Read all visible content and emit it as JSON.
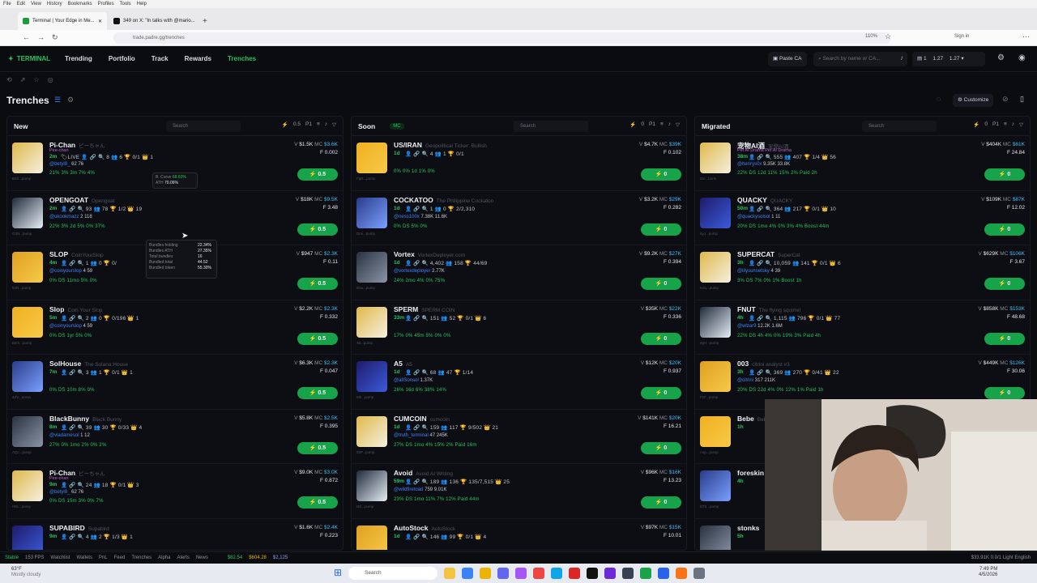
{
  "browser": {
    "menu": [
      "File",
      "Edit",
      "View",
      "History",
      "Bookmarks",
      "Profiles",
      "Tools",
      "Help"
    ],
    "tabs": [
      {
        "title": "Terminal | Your Edge in Me..."
      },
      {
        "title": "349 on X: \"In talks with @mario..."
      }
    ],
    "url": "trade.padre.gg/trenches",
    "zoom": "110%",
    "signin": "Sign in"
  },
  "nav": {
    "logo": "TERMINAL",
    "items": [
      "Trending",
      "Portfolio",
      "Track",
      "Rewards",
      "Trenches"
    ],
    "paste_ca": "Paste CA",
    "search_placeholder": "Search by name or CA...",
    "search_key": "/",
    "wallet_count": "1",
    "balance_a": "1.27",
    "balance_b": "1.27"
  },
  "page": {
    "title": "Trenches",
    "customize": "Customize"
  },
  "columns": [
    {
      "title": "New",
      "search": "Search",
      "preset": "0.5",
      "p": "P1",
      "cards": [
        {
          "name": "Pi-Chan",
          "desc": "ピーちゃん",
          "sub": "Pee-chan",
          "age": "2m",
          "stats": "🏷LIVE 👤 🔗 🔍 8  👥 6  🏆 0/1  👑 1",
          "handle": "@betyl8_",
          "handle_stats": "62  76",
          "bottom": "21%  3%  3m  7%  4%",
          "vol": "$1.5K",
          "mc": "$3.6K",
          "f": "F 0.002",
          "tx": "",
          "buy": "0.5",
          "addr": "BsX...pump"
        },
        {
          "name": "OPENGOAT",
          "desc": "Opengoat",
          "sub": "",
          "age": "2m",
          "stats": "👤 🔗 🔍 93  👥 78  🏆 1/2  👑 19",
          "handle": "@ukookmazz",
          "handle_stats": "2  118",
          "bottom": "22%  3%  2d  5%  0%  37%",
          "vol": "$18K",
          "mc": "$9.5K",
          "f": "F 3.48",
          "tx": "",
          "buy": "0.5",
          "addr": "G3N...pump"
        },
        {
          "name": "SLOP",
          "desc": "CoinYourSlop",
          "sub": "",
          "age": "4m",
          "stats": "👤 🔗 🔍 1  👥 0  🏆 0/",
          "handle": "@coinyourslop",
          "handle_stats": "4  59",
          "bottom": "0%  DS 11mo  5%  0%",
          "vol": "$947",
          "mc": "$2.3K",
          "f": "F 0.11",
          "tx": "",
          "buy": "0.5",
          "addr": "52N...pump"
        },
        {
          "name": "Slop",
          "desc": "Coin Your Slop",
          "sub": "",
          "age": "5m",
          "stats": "👤 🔗 🔍 2  👥 0  🏆 0/196  👑 1",
          "handle": "@coinyourslop",
          "handle_stats": "4  59",
          "bottom": "0%  DS 1yr  5%  0%",
          "vol": "$2.2K",
          "mc": "$2.3K",
          "f": "F 0.332",
          "tx": "",
          "buy": "0.5",
          "addr": "B2m...pump"
        },
        {
          "name": "SolHouse",
          "desc": "The Solana House",
          "sub": "",
          "age": "7m",
          "stats": "👤 🔗 🔍 3  👥 1  🏆 0/1  👑 1",
          "handle": "",
          "handle_stats": "",
          "bottom": "0%  DS 10m  8%  0%",
          "vol": "$6.3K",
          "mc": "$2.3K",
          "f": "F 0.047",
          "tx": "",
          "buy": "0.5",
          "addr": "4ZV...pump"
        },
        {
          "name": "BlackBunny",
          "desc": "Black Bunny",
          "sub": "",
          "age": "8m",
          "stats": "👤 🔗 🔍 39  👥 30  🏆 0/33  👑 4",
          "handle": "@vladamesol",
          "handle_stats": "1  12",
          "bottom": "27%  0%  1mo  2%  0%  2%",
          "vol": "$5.8K",
          "mc": "$2.5K",
          "f": "F 0.395",
          "tx": "",
          "buy": "0.5",
          "addr": "AQc...pump"
        },
        {
          "name": "Pi-Chan",
          "desc": "ピーちゃん",
          "sub": "Pee-chan",
          "age": "9m",
          "stats": "👤 🔗 🔍 24  👥 18  🏆 0/1  👑 3",
          "handle": "@betyl8_",
          "handle_stats": "62  76",
          "bottom": "0%  DS 15m  3%  0%  7%",
          "vol": "$9.0K",
          "mc": "$3.0K",
          "f": "F 0.872",
          "tx": "",
          "buy": "0.5",
          "addr": "H8c...pump"
        },
        {
          "name": "SUPABIRD",
          "desc": "Supabird",
          "sub": "",
          "age": "9m",
          "stats": "👤 🔗 🔍 4  👥 2  🏆 1/3  👑 1",
          "handle": "",
          "handle_stats": "",
          "bottom": "",
          "vol": "$1.6K",
          "mc": "$2.4K",
          "f": "F 0.223",
          "tx": "",
          "buy": "0.5",
          "addr": ""
        }
      ]
    },
    {
      "title": "Soon",
      "search": "Search",
      "preset": "0",
      "p": "P1",
      "mc_label": "MC",
      "cards": [
        {
          "name": "US/IRAN",
          "desc": "Geopolitical Ticker: Bullish",
          "sub": "",
          "age": "1d",
          "stats": "👤 🔗 🔍 4  👥 1  🏆 0/1",
          "handle": "",
          "handle_stats": "",
          "bottom": "0%  0%  1d  1%  0%",
          "vol": "$4.7K",
          "mc": "$39K",
          "f": "F 0.102",
          "tx": "",
          "buy": "0",
          "addr": "FgR...pump"
        },
        {
          "name": "COCKATOO",
          "desc": "The Philippine Cockatoo",
          "sub": "",
          "age": "1d",
          "stats": "👤 🔗 🔍 1  👥 0  🏆 2/2,310",
          "handle": "@ness100x",
          "handle_stats": "7.38K  11.6K",
          "bottom": "0%  DS  5%  0%",
          "vol": "$3.2K",
          "mc": "$29K",
          "f": "F 0.282",
          "tx": "",
          "buy": "0",
          "addr": "Dmi...pump"
        },
        {
          "name": "Vortex",
          "desc": "VortexDeployer.com",
          "sub": "",
          "age": "1d",
          "stats": "👤 🔗 🔍 4,402  👥 158  🏆 44/69",
          "handle": "@vortexdeployer",
          "handle_stats": "2.77K",
          "bottom": "24%  2mo  4%  0%  75%",
          "vol": "$9.2K",
          "mc": "$27K",
          "f": "F 0.394",
          "tx": "",
          "buy": "0",
          "addr": "5hw...pump"
        },
        {
          "name": "SPERM",
          "desc": "SPERM COIN",
          "sub": "",
          "age": "33m",
          "stats": "👤 🔗 🔍 151  👥 52  🏆 0/1  👑 6",
          "handle": "",
          "handle_stats": "",
          "bottom": "17%  0%  45m  5%  0%  0%",
          "vol": "$35K",
          "mc": "$22K",
          "f": "F 0.336",
          "tx": "",
          "buy": "0",
          "addr": "3tt...pump"
        },
        {
          "name": "A5",
          "desc": "A5",
          "sub": "",
          "age": "1d",
          "stats": "👤 🔗 🔍 68  👥 47  🏆 1/14",
          "handle": "@altSonsol",
          "handle_stats": "1.37K",
          "bottom": "26%  16d  6%  38%  14%",
          "vol": "$12K",
          "mc": "$20K",
          "f": "F 0.937",
          "tx": "",
          "buy": "0",
          "addr": "5th...pump"
        },
        {
          "name": "CUMCOIN",
          "desc": "cumcoin",
          "sub": "",
          "age": "1d",
          "stats": "👤 🔗 🔍 159  👥 117  🏆 9/502  👑 21",
          "handle": "@truth_terminal",
          "handle_stats": "47  245K",
          "bottom": "27%  DS 1mo  4%  15%  2%  Paid 16m",
          "vol": "$141K",
          "mc": "$20K",
          "f": "F 16.21",
          "tx": "",
          "buy": "0",
          "addr": "5bP...pump"
        },
        {
          "name": "Avoid",
          "desc": "Avoid AI Writing",
          "sub": "",
          "age": "59m",
          "stats": "👤 🔗 🔍 189  👥 136  🏆 135/7,515  👑 25",
          "handle": "@wildfiretoad",
          "handle_stats": "759  9.01K",
          "bottom": "23%  DS 1mo  11%  7%  12%  Paid 44m",
          "vol": "$96K",
          "mc": "$16K",
          "f": "F 13.23",
          "tx": "",
          "buy": "0",
          "addr": "Bsl...pump"
        },
        {
          "name": "AutoStock",
          "desc": "AutoStock",
          "sub": "",
          "age": "1d",
          "stats": "👤 🔗 🔍 146  👥 99  🏆 0/1  👑 4",
          "handle": "",
          "handle_stats": "",
          "bottom": "",
          "vol": "$97K",
          "mc": "$15K",
          "f": "F 10.01",
          "tx": "",
          "buy": "0",
          "addr": ""
        }
      ]
    },
    {
      "title": "Migrated",
      "search": "Search",
      "preset": "0",
      "p": "P1",
      "cards": [
        {
          "name": "宠物AI酒",
          "desc": "宠物AI酒",
          "sub": "Pet AI Drama  Pet AI Drama",
          "age": "38m",
          "stats": "👤 🔗 🔍 555  👥 407  🏆 1/4  👑 56",
          "handle": "@henrys0x",
          "handle_stats": "9.35K  33.8K",
          "bottom": "22%  DS 12d  11%  15%  2%  Paid 2h",
          "vol": "$404K",
          "mc": "$61K",
          "f": "F 24.84",
          "tx": "",
          "buy": "0",
          "addr": "Dvi...bonk"
        },
        {
          "name": "QUACKY",
          "desc": "QUACKY",
          "sub": "",
          "age": "50m",
          "stats": "👤 🔗 🔍 364  👥 217  🏆 0/1  👑 10",
          "handle": "@quackysolsol",
          "handle_stats": "1  11",
          "bottom": "20%  DS 1mo  4%  0%  3%  4%  Boost 44m",
          "vol": "$109K",
          "mc": "$87K",
          "f": "F 12.02",
          "tx": "",
          "buy": "0",
          "addr": "6yJ...pump"
        },
        {
          "name": "SUPERCAT",
          "desc": "SuperCat",
          "sub": "",
          "age": "3h",
          "stats": "👤 🔗 🔍 10,059  👥 141  🏆 0/1  👑 6",
          "handle": "@lilysunsetsky",
          "handle_stats": "4  39",
          "bottom": "3%  DS  7%  0%  1%  Boost 1h",
          "vol": "$629K",
          "mc": "$106K",
          "f": "F 3.67",
          "tx": "",
          "buy": "0",
          "addr": "HJu...pump"
        },
        {
          "name": "FNUT",
          "desc": "The flying squirrel",
          "sub": "",
          "age": "4h",
          "stats": "👤 🔗 🔍 1,115  👥 796  🏆 0/1  👑 77",
          "handle": "@wlzar9",
          "handle_stats": "12.2K  1.6M",
          "bottom": "22%  DS 4h  4%  0%  19%  3%  Paid 4h",
          "vol": "$858K",
          "mc": "$153K",
          "f": "F 48.68",
          "tx": "",
          "buy": "0",
          "addr": "6gH...pump"
        },
        {
          "name": "003",
          "desc": "citrini analyst #3",
          "sub": "",
          "age": "3h",
          "stats": "👤 🔗 🔍 369  👥 270  🏆 0/41  👑 22",
          "handle": "@citrini",
          "handle_stats": "317  211K",
          "bottom": "20%  DS 22d  4%  0%  12%  1%  Paid 1h",
          "vol": "$449K",
          "mc": "$126K",
          "f": "F 30.06",
          "tx": "",
          "buy": "0",
          "addr": "FzF...pump"
        },
        {
          "name": "Bebe",
          "desc": "Bebe",
          "sub": "",
          "age": "1h",
          "stats": "",
          "handle": "",
          "handle_stats": "",
          "bottom": "",
          "vol": "",
          "mc": "",
          "f": "",
          "tx": "",
          "buy": "0",
          "addr": "Axp...pump"
        },
        {
          "name": "foreskin",
          "desc": "",
          "sub": "",
          "age": "4h",
          "stats": "",
          "handle": "",
          "handle_stats": "",
          "bottom": "",
          "vol": "",
          "mc": "",
          "f": "",
          "tx": "",
          "buy": "0",
          "addr": "BT5...pump"
        },
        {
          "name": "stonks",
          "desc": "",
          "sub": "",
          "age": "5h",
          "stats": "",
          "handle": "",
          "handle_stats": "",
          "bottom": "",
          "vol": "",
          "mc": "",
          "f": "",
          "tx": "",
          "buy": "0",
          "addr": ""
        }
      ]
    }
  ],
  "tooltip1": {
    "line1": "B. Curve",
    "v1": "68.60%",
    "line2": "ATH",
    "v2": "70.06%"
  },
  "tooltip2": {
    "rows": [
      {
        "k": "Bundles holding",
        "v": "22.34%"
      },
      {
        "k": "Bundles ATH",
        "v": "27.35%"
      },
      {
        "k": "Total bundles",
        "v": "16"
      },
      {
        "k": "Bundled total",
        "v": "44.52"
      },
      {
        "k": "Bundled token",
        "v": "55.30%"
      }
    ]
  },
  "statusbar": {
    "stable": "Stable",
    "fps": "153 FPS",
    "items": [
      "Watchlist",
      "Wallets",
      "PnL",
      "Feed",
      "Trenches",
      "Alpha",
      "Alerts",
      "News"
    ],
    "sol": "$82.54",
    "btc": "$604.28",
    "eth": "$2,125",
    "right": "$33.91K  0.0/1  Light  English"
  },
  "taskbar": {
    "weather_temp": "63°F",
    "weather_desc": "Mostly cloudy",
    "search": "Search",
    "time": "7:49 PM",
    "date": "4/5/2026"
  },
  "colors": {
    "accent": "#22c55e",
    "mc": "#38bdf8",
    "danger": "#ef4444",
    "warn": "#eab308"
  }
}
